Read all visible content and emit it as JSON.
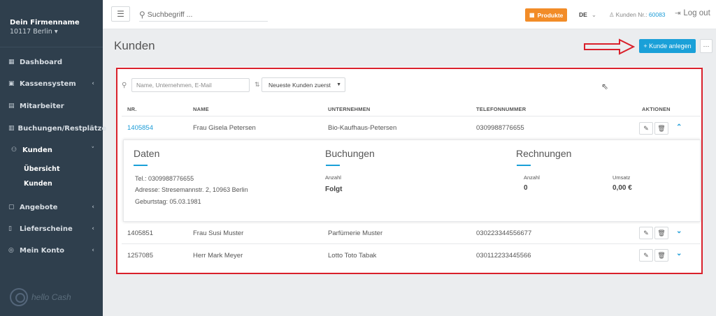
{
  "sidebar": {
    "company_name": "Dein Firmenname",
    "company_city": "10117 Berlin ▾",
    "items": [
      {
        "label": "Dashboard",
        "icon": "dashboard-icon",
        "glyph": "▦",
        "chevron": ""
      },
      {
        "label": "Kassensystem",
        "icon": "cash-register-icon",
        "glyph": "▣",
        "chevron": "‹"
      },
      {
        "label": "Mitarbeiter",
        "icon": "employees-icon",
        "glyph": "▤",
        "chevron": ""
      },
      {
        "label": "Buchungen/Restplätze",
        "icon": "bookings-icon",
        "glyph": "▥",
        "chevron": "‹"
      },
      {
        "label": "Kunden",
        "icon": "customers-icon",
        "glyph": "⚇",
        "chevron": "˅"
      },
      {
        "label": "Angebote",
        "icon": "offers-icon",
        "glyph": "▢",
        "chevron": "‹"
      },
      {
        "label": "Lieferscheine",
        "icon": "delivery-notes-icon",
        "glyph": "▯",
        "chevron": "‹"
      },
      {
        "label": "Mein Konto",
        "icon": "account-icon",
        "glyph": "◎",
        "chevron": "‹"
      }
    ],
    "subitems": [
      "Übersicht",
      "Kunden"
    ],
    "logo_text": "hello Cash"
  },
  "topbar": {
    "search_placeholder": "Suchbegriff ...",
    "products_label": "Produkte",
    "language": "DE",
    "customer_nr_label": "Kunden Nr.:",
    "customer_nr": "60083",
    "logout_label": "Log out"
  },
  "page": {
    "title": "Kunden",
    "add_button": "+ Kunde anlegen",
    "more_button": "···"
  },
  "filters": {
    "search_placeholder": "Name, Unternehmen, E-Mail",
    "sort_value": "Neueste Kunden zuerst"
  },
  "table": {
    "headers": [
      "NR.",
      "NAME",
      "UNTERNEHMEN",
      "TELEFONNUMMER",
      "AKTIONEN"
    ],
    "rows": [
      {
        "nr": "1405854",
        "name": "Frau Gisela Petersen",
        "company": "Bio-Kaufhaus-Petersen",
        "phone": "0309988776655",
        "expanded": true
      },
      {
        "nr": "1405851",
        "name": "Frau Susi Muster",
        "company": "Parfümerie Muster",
        "phone": "030223344556677",
        "expanded": false
      },
      {
        "nr": "1257085",
        "name": "Herr Mark Meyer",
        "company": "Lotto Toto Tabak",
        "phone": "030112233445566",
        "expanded": false
      }
    ]
  },
  "detail": {
    "daten_title": "Daten",
    "tel": "Tel.: 0309988776655",
    "address": "Adresse: Stresemannstr. 2, 10963 Berlin",
    "birthday": "Geburtstag: 05.03.1981",
    "buchungen_title": "Buchungen",
    "buchungen_label": "Anzahl",
    "buchungen_value": "Folgt",
    "rechnungen_title": "Rechnungen",
    "rechnungen_count_label": "Anzahl",
    "rechnungen_count": "0",
    "rechnungen_sum_label": "Umsatz",
    "rechnungen_sum": "0,00 €"
  },
  "colors": {
    "sidebar_bg": "#2f3f4d",
    "accent_blue": "#1aa0d8",
    "products_orange": "#f28c28",
    "highlight_red": "#d9202b"
  }
}
